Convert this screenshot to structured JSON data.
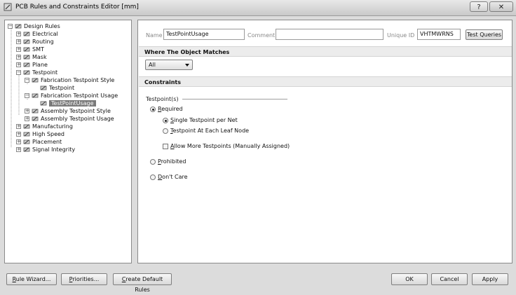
{
  "window": {
    "title": "PCB Rules and Constraints Editor [mm]",
    "help_label": "?",
    "close_label": "✕"
  },
  "tree": [
    {
      "label": "Design Rules",
      "indent": 0,
      "exp": "−",
      "icon": "folder-icon"
    },
    {
      "label": "Electrical",
      "indent": 1,
      "exp": "+",
      "icon": "electrical-icon"
    },
    {
      "label": "Routing",
      "indent": 1,
      "exp": "+",
      "icon": "routing-icon"
    },
    {
      "label": "SMT",
      "indent": 1,
      "exp": "+",
      "icon": "smt-icon"
    },
    {
      "label": "Mask",
      "indent": 1,
      "exp": "+",
      "icon": "mask-icon"
    },
    {
      "label": "Plane",
      "indent": 1,
      "exp": "+",
      "icon": "plane-icon"
    },
    {
      "label": "Testpoint",
      "indent": 1,
      "exp": "−",
      "icon": "testpoint-icon"
    },
    {
      "label": "Fabrication Testpoint Style",
      "indent": 2,
      "exp": "−",
      "icon": "testpoint-rule-icon"
    },
    {
      "label": "Testpoint",
      "indent": 3,
      "exp": "",
      "icon": "testpoint-rule-icon"
    },
    {
      "label": "Fabrication Testpoint Usage",
      "indent": 2,
      "exp": "−",
      "icon": "testpoint-rule-icon"
    },
    {
      "label": "TestPointUsage",
      "indent": 3,
      "exp": "",
      "icon": "testpoint-rule-icon",
      "selected": true
    },
    {
      "label": "Assembly Testpoint Style",
      "indent": 2,
      "exp": "+",
      "icon": "testpoint-rule-icon"
    },
    {
      "label": "Assembly Testpoint Usage",
      "indent": 2,
      "exp": "+",
      "icon": "testpoint-rule-icon"
    },
    {
      "label": "Manufacturing",
      "indent": 1,
      "exp": "+",
      "icon": "manufacturing-icon"
    },
    {
      "label": "High Speed",
      "indent": 1,
      "exp": "+",
      "icon": "high-speed-icon"
    },
    {
      "label": "Placement",
      "indent": 1,
      "exp": "+",
      "icon": "placement-icon"
    },
    {
      "label": "Signal Integrity",
      "indent": 1,
      "exp": "+",
      "icon": "signal-integrity-icon"
    }
  ],
  "rule": {
    "name_label": "Name",
    "name_value": "TestPointUsage",
    "comment_label": "Comment",
    "comment_value": "",
    "uid_label": "Unique ID",
    "uid_value": "VHTMWRNS",
    "test_queries_label": "Test Queries"
  },
  "match": {
    "header": "Where The Object Matches",
    "selected": "All"
  },
  "constraints": {
    "header": "Constraints",
    "group_label": "Testpoint(s)",
    "required": {
      "hot": "R",
      "rest": "equired",
      "checked": true
    },
    "single": {
      "hot": "S",
      "rest": "ingle Testpoint per Net",
      "checked": true
    },
    "each_leaf": {
      "hot": "T",
      "rest": "estpoint At Each Leaf Node",
      "checked": false
    },
    "allow_more": {
      "hot": "A",
      "rest": "llow More Testpoints (Manually Assigned)",
      "checked": false
    },
    "prohibited": {
      "hot": "P",
      "rest": "rohibited",
      "checked": false
    },
    "dont_care": {
      "hot": "D",
      "rest": "on't Care",
      "checked": false
    }
  },
  "buttons": {
    "rule_wizard": {
      "hot": "R",
      "rest": "ule Wizard..."
    },
    "priorities": {
      "hot": "P",
      "rest": "riorities..."
    },
    "create_default": {
      "hot": "C",
      "rest": "reate Default Rules"
    },
    "ok": "OK",
    "cancel": "Cancel",
    "apply": "Apply"
  }
}
